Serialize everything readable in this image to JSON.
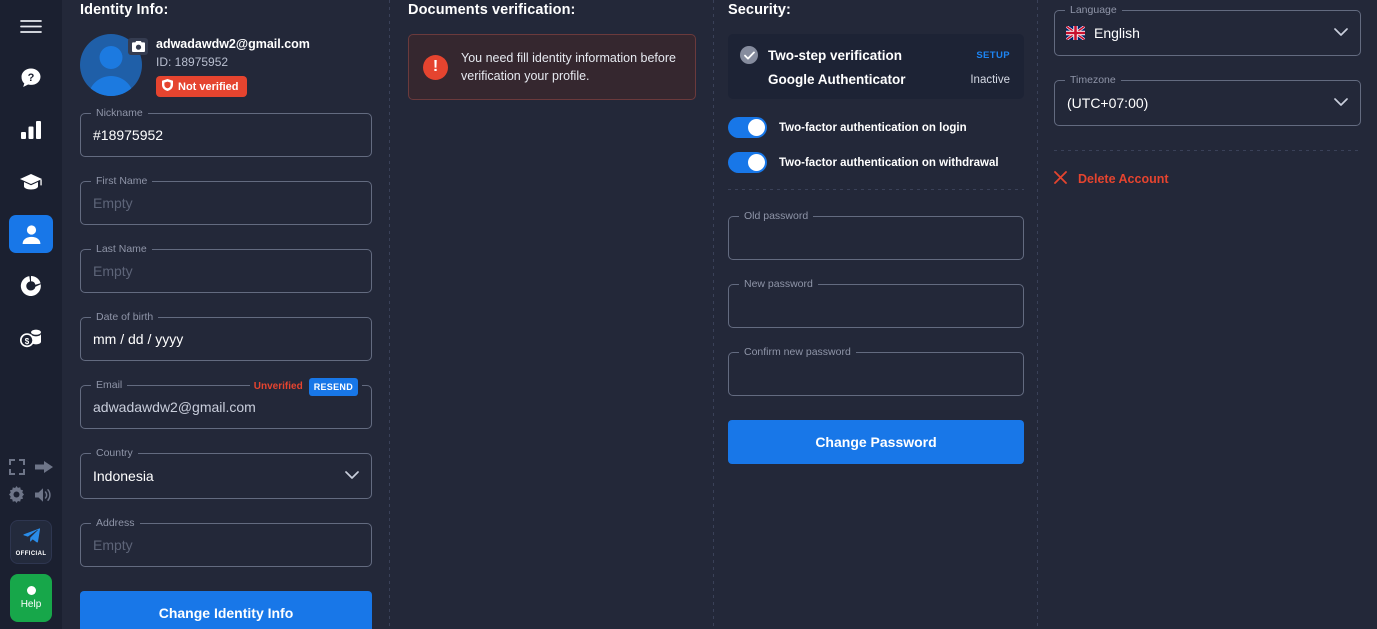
{
  "sidebar": {
    "items": [
      {
        "name": "menu",
        "icon": "hamburger-icon",
        "active": false
      },
      {
        "name": "help",
        "icon": "question-bubble-icon",
        "active": false
      },
      {
        "name": "analytics",
        "icon": "bar-chart-icon",
        "active": false
      },
      {
        "name": "education",
        "icon": "graduation-cap-icon",
        "active": false
      },
      {
        "name": "profile",
        "icon": "user-icon",
        "active": true
      },
      {
        "name": "history",
        "icon": "pie-chart-icon",
        "active": false
      },
      {
        "name": "finance",
        "icon": "coins-icon",
        "active": false
      }
    ],
    "bottom": {
      "fullscreen_icon": "fullscreen-icon",
      "logout_icon": "arrow-right-icon",
      "settings_icon": "gear-icon",
      "sound_icon": "speaker-icon",
      "official_label": "OFFICIAL",
      "official_icon": "telegram-icon",
      "help_label": "Help",
      "help_icon": "dot-icon"
    }
  },
  "identity": {
    "title": "Identity Info:",
    "email": "adwadawdw2@gmail.com",
    "id_label": "ID: 18975952",
    "status_badge": "Not verified",
    "avatar_camera_icon": "camera-icon",
    "fields": {
      "nickname": {
        "label": "Nickname",
        "value": "#18975952",
        "placeholder": ""
      },
      "first_name": {
        "label": "First Name",
        "value": "",
        "placeholder": "Empty"
      },
      "last_name": {
        "label": "Last Name",
        "value": "",
        "placeholder": "Empty"
      },
      "dob": {
        "label": "Date of birth",
        "value": "mm / dd / yyyy",
        "placeholder": "mm / dd / yyyy"
      },
      "email": {
        "label": "Email",
        "value": "adwadawdw2@gmail.com",
        "right_status": "Unverified",
        "resend_label": "RESEND"
      },
      "country": {
        "label": "Country",
        "value": "Indonesia"
      },
      "address": {
        "label": "Address",
        "value": "",
        "placeholder": "Empty"
      }
    },
    "submit_label": "Change Identity Info"
  },
  "documents": {
    "title": "Documents verification:",
    "alert_text": "You need fill identity information before verification your profile.",
    "alert_icon": "exclamation-icon"
  },
  "security": {
    "title": "Security:",
    "two_step": {
      "label": "Two-step verification",
      "action": "SETUP",
      "check_icon": "check-circle-icon"
    },
    "google_auth": {
      "label": "Google Authenticator",
      "status": "Inactive"
    },
    "toggles": [
      {
        "label": "Two-factor authentication on login",
        "on": true
      },
      {
        "label": "Two-factor authentication on withdrawal",
        "on": true
      }
    ],
    "password": {
      "old": {
        "label": "Old password",
        "value": ""
      },
      "new": {
        "label": "New password",
        "value": ""
      },
      "confirm": {
        "label": "Confirm new password",
        "value": ""
      },
      "submit_label": "Change Password"
    }
  },
  "preferences": {
    "language": {
      "label": "Language",
      "value": "English",
      "flag_icon": "uk-flag-icon"
    },
    "timezone": {
      "label": "Timezone",
      "value": "(UTC+07:00)"
    },
    "delete_account": {
      "label": "Delete Account",
      "icon": "close-x-icon"
    }
  },
  "colors": {
    "accent_blue": "#1877e8",
    "danger_red": "#e5442f",
    "bg": "#232839",
    "sidebar_bg": "#1b2030",
    "card_bg": "#1d2335",
    "help_green": "#17a74a"
  }
}
